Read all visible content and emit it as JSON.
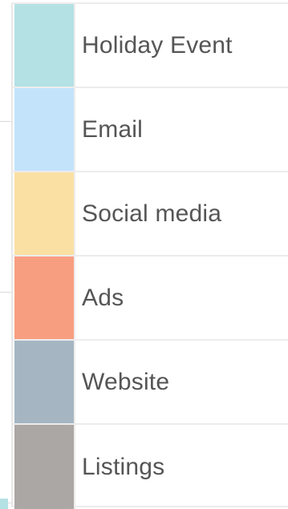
{
  "legend": {
    "items": [
      {
        "label": "Holiday Event",
        "color": "#b4e1e4"
      },
      {
        "label": "Email",
        "color": "#c3e3fb"
      },
      {
        "label": "Social media",
        "color": "#fbe0a3"
      },
      {
        "label": "Ads",
        "color": "#f89e80"
      },
      {
        "label": "Website",
        "color": "#a5b6c2"
      },
      {
        "label": "Listings",
        "color": "#aba7a5"
      }
    ]
  }
}
